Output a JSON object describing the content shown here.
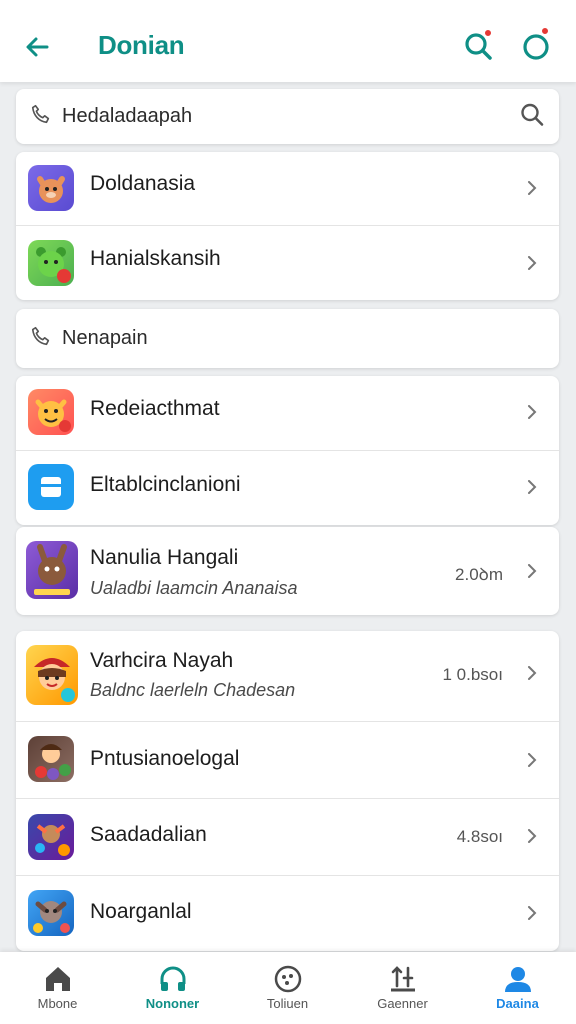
{
  "header": {
    "title": "Donian",
    "accent": "#0f8f86"
  },
  "search_section": {
    "label": "Hedaladaapah",
    "icon": "phone-icon",
    "right_icon": "search-icon"
  },
  "section2": {
    "label": "Nenapain",
    "icon": "phone-icon"
  },
  "group1": [
    {
      "name": "Doldanasia",
      "icon": "fox-app-icon"
    },
    {
      "name": "Hanialskansih",
      "icon": "green-bear-app-icon"
    }
  ],
  "group2": [
    {
      "name": "Redeiacthmat",
      "icon": "tiger-app-icon"
    },
    {
      "name": "Eltablcinclanioni",
      "icon": "blue-square-app-icon"
    }
  ],
  "group3": [
    {
      "name": "Nanulia Hangali",
      "sub": "Ualadbi laamcin Ananaisa",
      "meta": "2.0ꝺm",
      "icon": "bunny-app-icon"
    }
  ],
  "group4": [
    {
      "name": "Varhcira Nayah",
      "sub": "Baldnc laerleln Chadesan",
      "meta": "1 0.bsoı",
      "icon": "girl-app-icon"
    },
    {
      "name": "Pntusianoelogal",
      "icon": "game-app-icon"
    },
    {
      "name": "Saadadalian",
      "meta": "4.8soı",
      "icon": "warrior-app-icon"
    },
    {
      "name": "Noarganlal",
      "icon": "adventure-app-icon"
    }
  ],
  "bottom_nav": [
    {
      "label": "Mbone",
      "icon": "home-icon"
    },
    {
      "label": "Nononer",
      "icon": "headphones-icon"
    },
    {
      "label": "Toliuen",
      "icon": "menu-dots-icon"
    },
    {
      "label": "Gaenner",
      "icon": "tools-icon"
    },
    {
      "label": "Daaina",
      "icon": "profile-icon"
    }
  ]
}
